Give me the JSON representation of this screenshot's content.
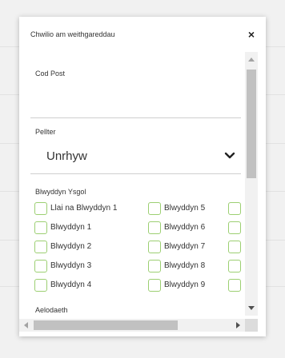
{
  "dialog": {
    "title": "Chwilio am weithgareddau",
    "close_label": "×"
  },
  "form": {
    "postcode_label": "Cod Post",
    "postcode_value": "",
    "distance_label": "Pellter",
    "distance_value": "Unrhyw",
    "school_year_label": "Blwyddyn Ysgol",
    "school_years_col1": [
      "Llai na Blwyddyn 1",
      "Blwyddyn 1",
      "Blwyddyn 2",
      "Blwyddyn 3",
      "Blwyddyn 4"
    ],
    "school_years_col2": [
      "Blwyddyn 5",
      "Blwyddyn 6",
      "Blwyddyn 7",
      "Blwyddyn 8",
      "Blwyddyn 9"
    ],
    "membership_label": "Aelodaeth"
  },
  "colors": {
    "checkbox_border": "#9ccf72"
  }
}
